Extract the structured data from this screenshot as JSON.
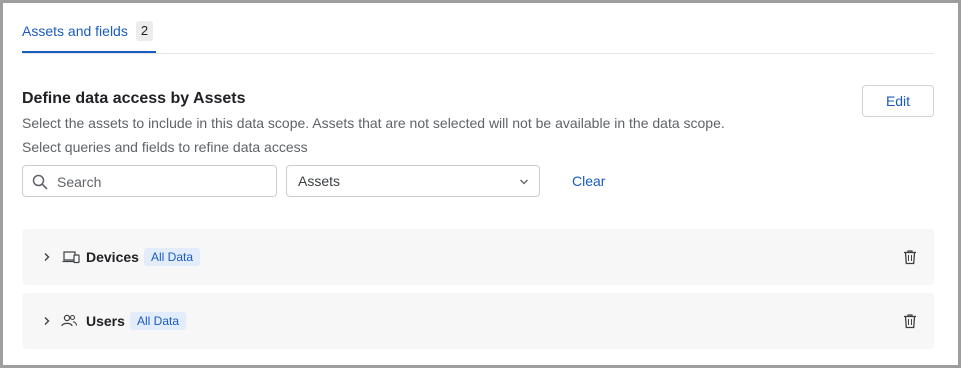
{
  "tabs": [
    {
      "label": "Assets and fields",
      "count": "2",
      "active": true
    }
  ],
  "section": {
    "title": "Define data access by Assets",
    "description": "Select the assets to include in this data scope. Assets that are not selected will not be available in the data scope.",
    "refine_hint": "Select queries and fields to refine data access",
    "edit_label": "Edit"
  },
  "filters": {
    "search_placeholder": "Search",
    "search_icon": "search-icon",
    "select_value": "Assets",
    "select_icon": "chevron-down-icon",
    "clear_label": "Clear"
  },
  "assets": [
    {
      "name": "Devices",
      "badge": "All Data",
      "icon": "devices-icon"
    },
    {
      "name": "Users",
      "badge": "All Data",
      "icon": "users-icon"
    }
  ],
  "colors": {
    "accent": "#1a5bbf",
    "badge_bg": "#e3ecfb",
    "row_bg": "#f7f7f7",
    "border": "#9e9e9e"
  }
}
